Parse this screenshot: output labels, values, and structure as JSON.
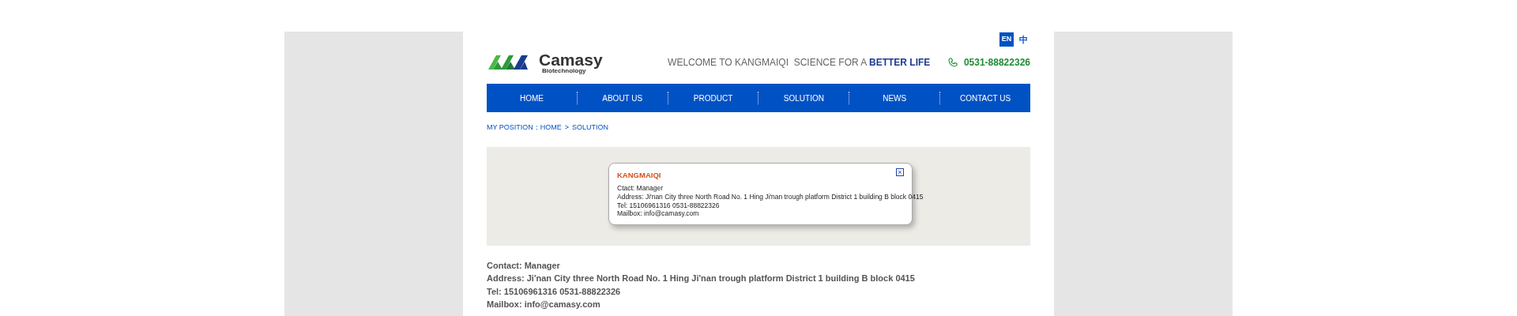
{
  "languages": [
    {
      "label": "EN",
      "selected": true
    },
    {
      "label": "中",
      "selected": false
    }
  ],
  "logo": {
    "name": "Camasy",
    "subtitle": "Biotechnology"
  },
  "slogan": {
    "text": "WELCOME TO KANGMAIQI  SCIENCE FOR A",
    "highlight": "BETTER LIFE"
  },
  "phone": "0531-88822326",
  "nav": [
    "HOME",
    "ABOUT US",
    "PRODUCT",
    "SOLUTION",
    "NEWS",
    "CONTACT US"
  ],
  "breadcrumb": {
    "label": "MY POSITION：",
    "items": [
      "HOME",
      "SOLUTION"
    ],
    "separator": ">"
  },
  "map_popup": {
    "title": "KANGMAIQI",
    "close": "×",
    "lines": [
      "Ctact: Manager",
      "Address: Ji'nan City three North Road No. 1 Hing Ji'nan trough platform District 1 building B block 0415",
      "Tel: 15106961316 0531-88822326",
      "Mailbox: info@camasy.com"
    ]
  },
  "contact_lines": [
    "Contact: Manager",
    "Address: Ji'nan City three North Road No. 1 Hing Ji'nan trough platform District 1 building B block 0415",
    "Tel: 15106961316 0531-88822326",
    "Mailbox: info@camasy.com"
  ]
}
